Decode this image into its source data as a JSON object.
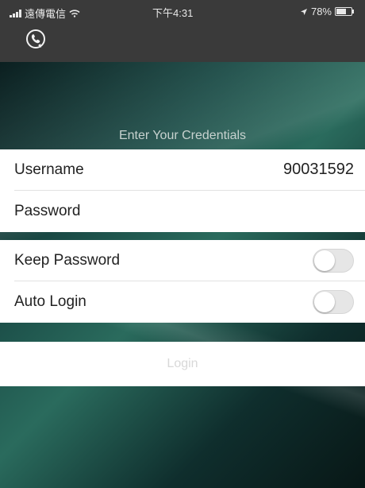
{
  "status_bar": {
    "carrier": "遠傳電信",
    "time": "下午4:31",
    "battery": "78%",
    "battery_level": 0.78
  },
  "toolbar": {
    "icon": "phone-icon"
  },
  "form": {
    "title": "Enter Your Credentials",
    "username_label": "Username",
    "username_value": "90031592",
    "password_label": "Password",
    "password_value": "",
    "keep_password_label": "Keep Password",
    "keep_password_on": false,
    "auto_login_label": "Auto Login",
    "auto_login_on": false,
    "login_label": "Login"
  },
  "colors": {
    "toolbar_bg": "#3a3a3a",
    "background_accent": "#2a6b5d",
    "toggle_off": "#e6e6e6",
    "login_text_disabled": "#d8d8d8"
  }
}
